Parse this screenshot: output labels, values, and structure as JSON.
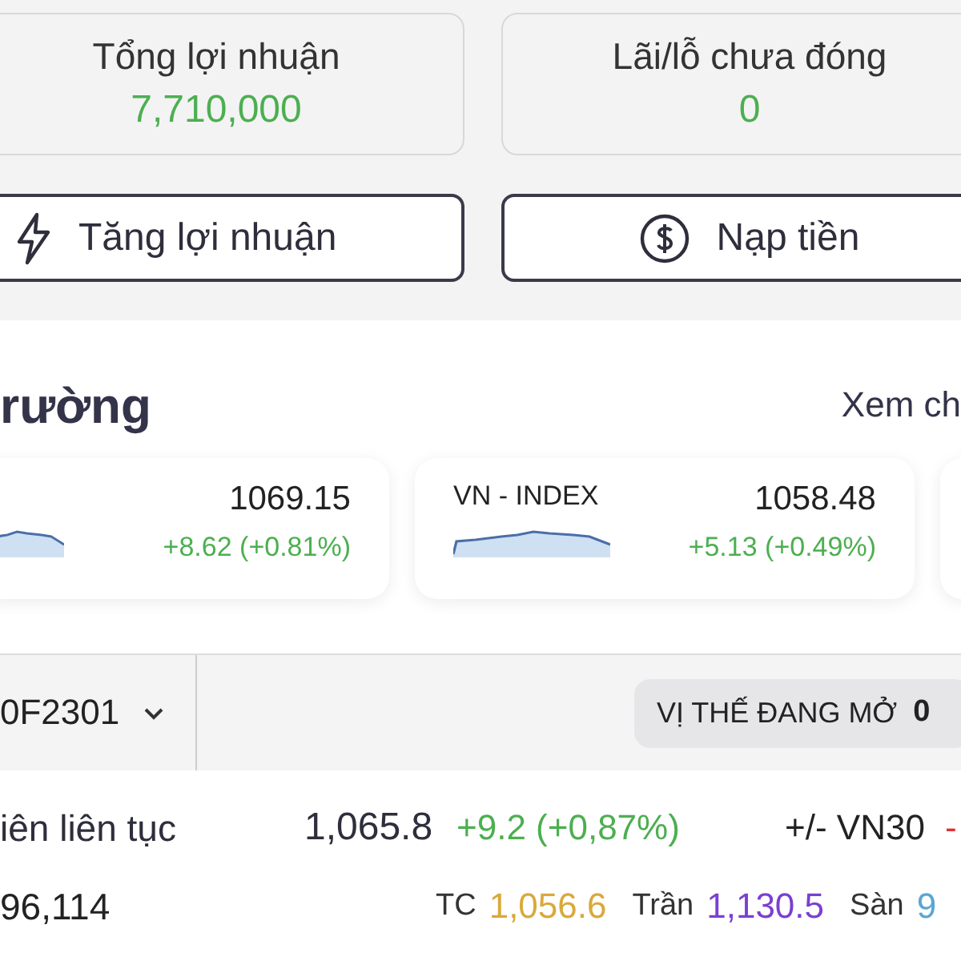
{
  "summary": [
    {
      "label": "Tổng lợi nhuận",
      "value": "7,710,000"
    },
    {
      "label": "Lãi/lỗ chưa đóng",
      "value": "0"
    }
  ],
  "actions": [
    {
      "kind": "bolt",
      "label": "Tăng lợi nhuận"
    },
    {
      "kind": "dollar",
      "label": "Nạp tiền"
    }
  ],
  "market": {
    "title": "rường",
    "link": "Xem ch",
    "indices": [
      {
        "price": "1069.15",
        "change": "+8.62 (+0.81%)"
      },
      {
        "name": "VN - INDEX",
        "price": "1058.48",
        "change": "+5.13 (+0.49%)"
      }
    ]
  },
  "contract": {
    "symbol": "0F2301",
    "positions_label": "VỊ THẾ ĐANG MỞ",
    "positions_count": "0"
  },
  "quote": {
    "label": "iên liên tục",
    "price": "1,065.8",
    "change": "+9.2 (+0,87%)",
    "basis_label": "+/- VN30",
    "basis_value": "-"
  },
  "volume": "96,114",
  "levels": [
    {
      "label": "TC",
      "value": "1,056.6",
      "color": "#d9a93a"
    },
    {
      "label": "Trần",
      "value": "1,130.5",
      "color": "#7b3fd1"
    },
    {
      "label": "Sàn",
      "value": "9",
      "color": "#5aa6d4"
    }
  ]
}
